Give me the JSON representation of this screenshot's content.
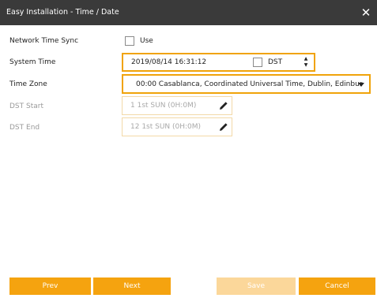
{
  "window": {
    "title": "Easy Installation - Time / Date",
    "close_glyph": "✕"
  },
  "form": {
    "network_time_sync": {
      "label": "Network Time Sync",
      "checkbox_label": "Use",
      "checked": false
    },
    "system_time": {
      "label": "System Time",
      "value": "2019/08/14 16:31:12",
      "dst_label": "DST",
      "dst_checked": false,
      "spin_up": "▲",
      "spin_down": "▼"
    },
    "time_zone": {
      "label": "Time Zone",
      "value": "00:00 Casablanca, Coordinated Universal Time, Dublin, Edinbur"
    },
    "dst_start": {
      "label": "DST Start",
      "value": "1 1st SUN (0H:0M)"
    },
    "dst_end": {
      "label": "DST End",
      "value": "12 1st SUN (0H:0M)"
    }
  },
  "buttons": {
    "prev": "Prev",
    "next": "Next",
    "save": "Save",
    "cancel": "Cancel"
  },
  "colors": {
    "accent": "#f5a30f",
    "accent_disabled": "#fbd79a",
    "titlebar": "#3a3a3a"
  },
  "icons": {
    "close": "close-icon",
    "pencil": "pencil-icon",
    "dropdown": "chevron-down-icon",
    "spinner": "spinner-arrows-icon"
  }
}
